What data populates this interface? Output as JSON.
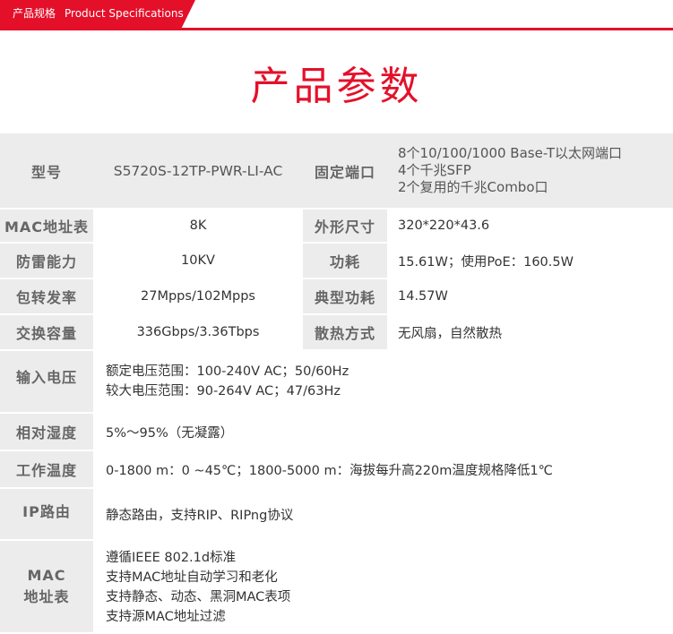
{
  "header": {
    "tab_cn": "产品规格",
    "tab_en": "Product Specifications"
  },
  "title": "产品参数",
  "model": {
    "label": "型号",
    "value": "S5720S-12TP-PWR-LI-AC"
  },
  "fixed_ports": {
    "label": "固定端口",
    "lines": [
      "8个10/100/1000 Base-T以太网端口",
      "4个千兆SFP",
      "2个复用的千兆Combo口"
    ]
  },
  "rows_pair": [
    {
      "l1": "MAC地址表",
      "v1": "8K",
      "l2": "外形尺寸",
      "v2": "320*220*43.6"
    },
    {
      "l1": "防雷能力",
      "v1": "10KV",
      "l2": "功耗",
      "v2": "15.61W；使用PoE：160.5W"
    },
    {
      "l1": "包转发率",
      "v1": "27Mpps/102Mpps",
      "l2": "典型功耗",
      "v2": "14.57W"
    },
    {
      "l1": "交换容量",
      "v1": "336Gbps/3.36Tbps",
      "l2": "散热方式",
      "v2": "无风扇，自然散热"
    }
  ],
  "input_voltage": {
    "label": "输入电压",
    "lines": [
      "额定电压范围：100-240V AC；50/60Hz",
      "较大电压范围：90-264V AC；47/63Hz"
    ]
  },
  "humidity": {
    "label": "相对湿度",
    "value": "5%～95%（无凝露）"
  },
  "temperature": {
    "label": "工作温度",
    "value": "0-1800 m：0 ~45℃；1800-5000 m：海拔每升高220m温度规格降低1℃"
  },
  "ip_routing": {
    "label": "IP路由",
    "value": "静态路由，支持RIP、RIPng协议"
  },
  "mac_table": {
    "label_line1": "MAC",
    "label_line2": "地址表",
    "lines": [
      "遵循IEEE 802.1d标准",
      "支持MAC地址自动学习和老化",
      "支持静态、动态、黑洞MAC表项",
      "支持源MAC地址过滤"
    ]
  }
}
